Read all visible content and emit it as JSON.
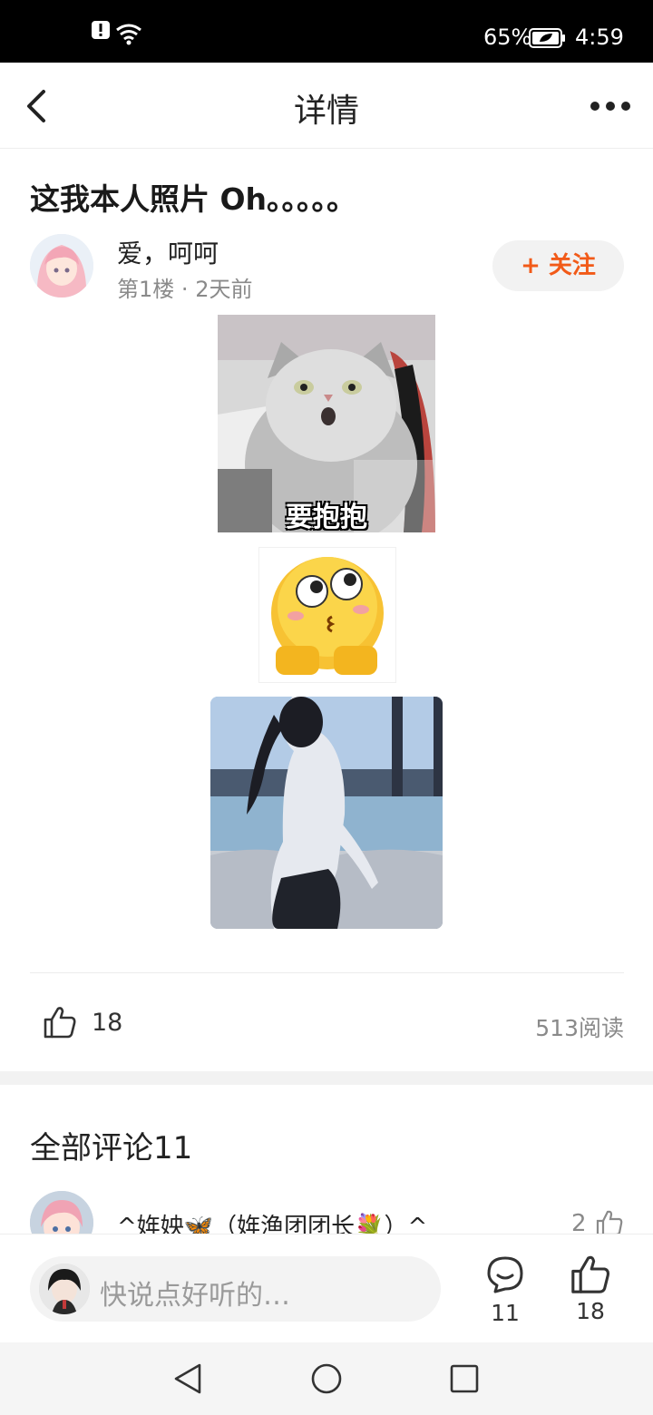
{
  "status_bar": {
    "battery_percent": "65%",
    "time": "4:59",
    "icons": [
      "alert-icon",
      "wifi-icon",
      "battery-icon"
    ]
  },
  "nav": {
    "title": "详情",
    "back_icon": "chevron-left-icon",
    "more_icon": "more-dots-icon"
  },
  "post": {
    "title": "这我本人照片 Oh。。。。。",
    "author_name": "爱，呵呵",
    "floor": "第1楼",
    "separator": "·",
    "time_ago": "2天前",
    "follow_label": "+ 关注",
    "images": [
      {
        "name": "cat-meme",
        "caption": "要抱抱"
      },
      {
        "name": "emoji-sticker"
      },
      {
        "name": "girl-photo"
      }
    ],
    "like_count": "18",
    "read_count": "513阅读"
  },
  "comments": {
    "header": "全部评论11",
    "items": [
      {
        "name": "^姩姎🦋（姩渔团团长💐）^",
        "like_count": "2"
      }
    ]
  },
  "bottom_bar": {
    "input_placeholder": "快说点好听的…",
    "comment_count": "11",
    "like_count": "18"
  },
  "colors": {
    "accent": "#f25a18",
    "status_bar_bg": "#000000",
    "muted_text": "#8a8a8a"
  }
}
